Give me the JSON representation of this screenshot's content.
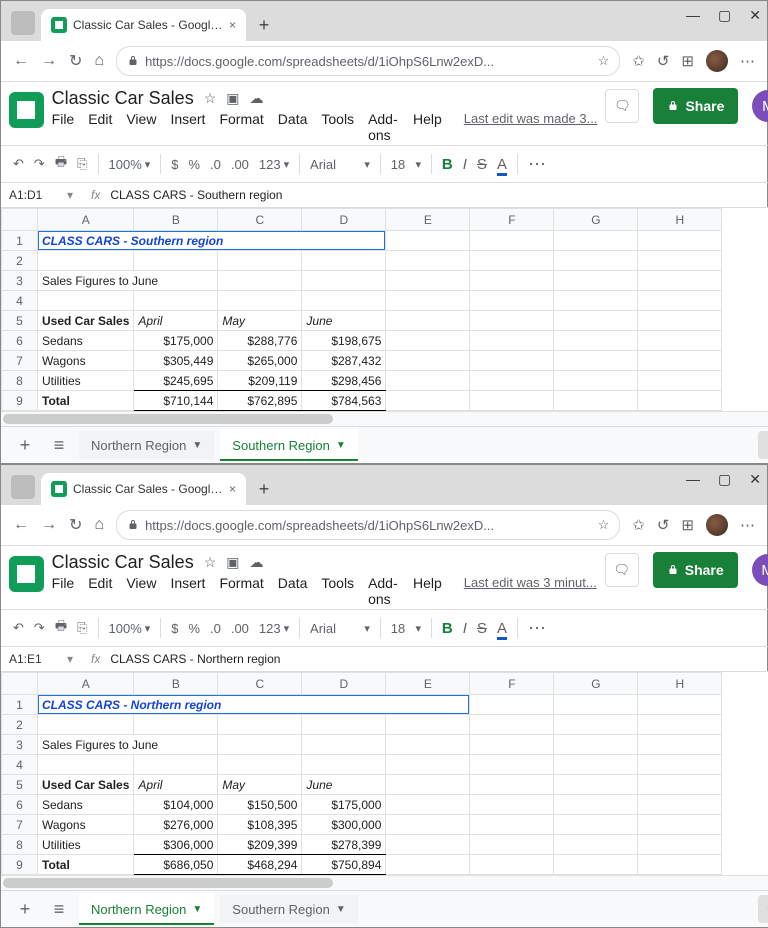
{
  "windows": [
    {
      "tab_title": "Classic Car Sales - Google Sheets",
      "url": "https://docs.google.com/spreadsheets/d/1iOhpS6Lnw2exD...",
      "doc_title": "Classic Car Sales",
      "menus": [
        "File",
        "Edit",
        "View",
        "Insert",
        "Format",
        "Data",
        "Tools",
        "Add-ons",
        "Help"
      ],
      "last_edit": "Last edit was made 3...",
      "share": "Share",
      "avatar": "M",
      "toolbar": {
        "zoom": "100%",
        "font": "Arial",
        "size": "18"
      },
      "namebox": "A1:D1",
      "formula": "CLASS CARS - Southern region",
      "cols": [
        "A",
        "B",
        "C",
        "D",
        "E",
        "F",
        "G",
        "H"
      ],
      "rows": [
        "1",
        "2",
        "3",
        "4",
        "5",
        "6",
        "7",
        "8",
        "9"
      ],
      "title_cell": "CLASS CARS - Southern region",
      "sel_span": 4,
      "r3": "Sales Figures to June",
      "r5": {
        "a": "Used Car Sales",
        "b": "April",
        "c": "May",
        "d": "June"
      },
      "data": [
        {
          "a": "Sedans",
          "b": "$175,000",
          "c": "$288,776",
          "d": "$198,675"
        },
        {
          "a": "Wagons",
          "b": "$305,449",
          "c": "$265,000",
          "d": "$287,432"
        },
        {
          "a": "Utilities",
          "b": "$245,695",
          "c": "$209,119",
          "d": "$298,456"
        }
      ],
      "total": {
        "a": "Total",
        "b": "$710,144",
        "c": "$762,895",
        "d": "$784,563"
      },
      "tabs": [
        {
          "label": "Northern Region",
          "active": false
        },
        {
          "label": "Southern Region",
          "active": true
        }
      ]
    },
    {
      "tab_title": "Classic Car Sales - Google Sheets",
      "url": "https://docs.google.com/spreadsheets/d/1iOhpS6Lnw2exD...",
      "doc_title": "Classic Car Sales",
      "menus": [
        "File",
        "Edit",
        "View",
        "Insert",
        "Format",
        "Data",
        "Tools",
        "Add-ons",
        "Help"
      ],
      "last_edit": "Last edit was 3 minut...",
      "share": "Share",
      "avatar": "M",
      "toolbar": {
        "zoom": "100%",
        "font": "Arial",
        "size": "18"
      },
      "namebox": "A1:E1",
      "formula": "CLASS CARS - Northern region",
      "cols": [
        "A",
        "B",
        "C",
        "D",
        "E",
        "F",
        "G",
        "H"
      ],
      "rows": [
        "1",
        "2",
        "3",
        "4",
        "5",
        "6",
        "7",
        "8",
        "9"
      ],
      "title_cell": "CLASS CARS - Northern region",
      "sel_span": 5,
      "r3": "Sales Figures to June",
      "r5": {
        "a": "Used Car Sales",
        "b": "April",
        "c": "May",
        "d": "June"
      },
      "data": [
        {
          "a": "Sedans",
          "b": "$104,000",
          "c": "$150,500",
          "d": "$175,000"
        },
        {
          "a": "Wagons",
          "b": "$276,000",
          "c": "$108,395",
          "d": "$300,000"
        },
        {
          "a": "Utilities",
          "b": "$306,000",
          "c": "$209,399",
          "d": "$278,399"
        }
      ],
      "total": {
        "a": "Total",
        "b": "$686,050",
        "c": "$468,294",
        "d": "$750,894"
      },
      "tabs": [
        {
          "label": "Northern Region",
          "active": true
        },
        {
          "label": "Southern Region",
          "active": false
        }
      ]
    }
  ]
}
